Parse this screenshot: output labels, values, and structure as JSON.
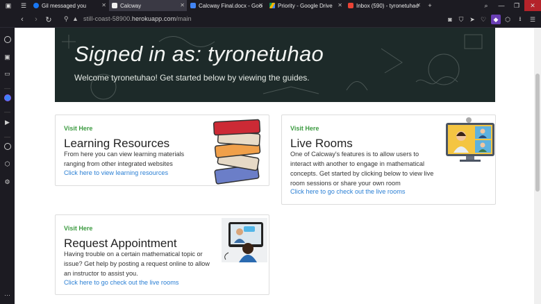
{
  "tabs": [
    {
      "title": "Gil messaged you",
      "active": false
    },
    {
      "title": "Calcway",
      "active": true
    },
    {
      "title": "Calcway Final.docx - Googl",
      "active": false
    },
    {
      "title": "Priority - Google Drive",
      "active": false
    },
    {
      "title": "Inbox (590) - tyronetuhao",
      "active": false
    }
  ],
  "new_tab": "+",
  "address": {
    "host": "still-coast-58900.",
    "domain": "herokuapp.com",
    "path": "/main"
  },
  "hero": {
    "title": "Signed in as: tyronetuhao",
    "subtitle": "Welcome tyronetuhao! Get started below by viewing the guides."
  },
  "cards": {
    "learning": {
      "visit": "Visit Here",
      "title": "Learning Resources",
      "line1": "From here you can view learning materials",
      "line2": "ranging from other integrated websites",
      "link": "Click here to view learning resources"
    },
    "live": {
      "visit": "Visit Here",
      "title": "Live Rooms",
      "line1": "One of Calcway's features is to allow users to",
      "line2": "interact with another to engage in mathematical",
      "line3": "concepts. Get started by clicking below to view live",
      "line4": "room sessions or share your own room",
      "link": "Click here to go check out the live rooms"
    },
    "appointment": {
      "visit": "Visit Here",
      "title": "Request Appointment",
      "line1": "Having trouble on a certain mathematical topic or",
      "line2": "issue? Get help by posting a request online to allow",
      "line3": "an instructor to assist you.",
      "link": "Click here to go check out the live rooms"
    }
  },
  "colors": {
    "accent_green": "#3c9b41",
    "link_blue": "#2a7fd4",
    "hero_bg": "#1d2a29"
  }
}
